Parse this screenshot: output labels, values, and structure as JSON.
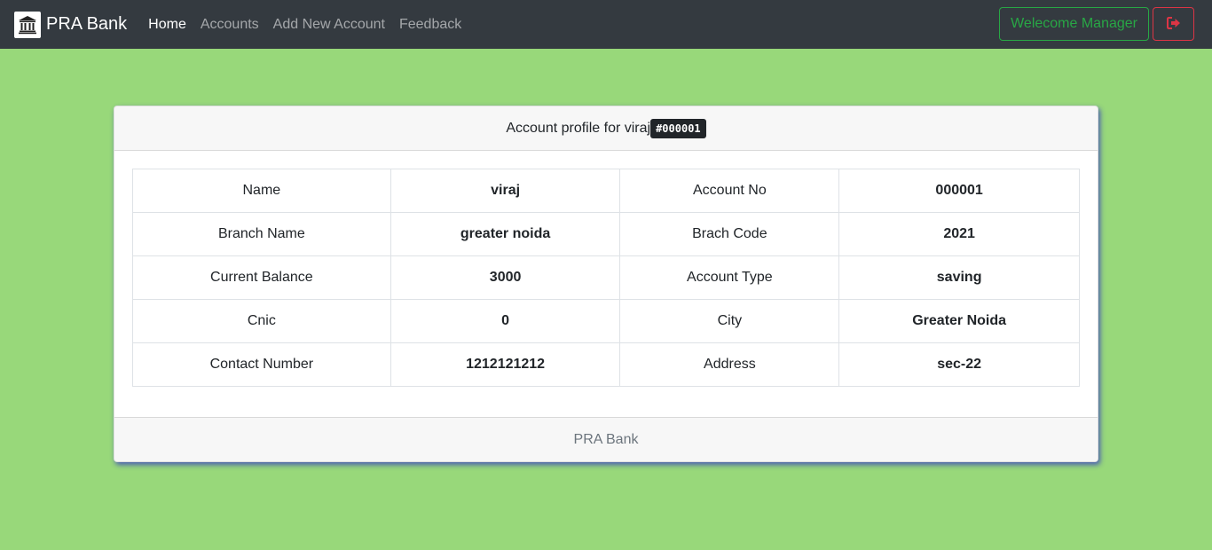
{
  "colors": {
    "page_background": "#98d87a",
    "navbar_background": "#343a40",
    "welcome_accent": "#28a745",
    "logout_accent": "#dc3545",
    "card_shadow": "#3c46be"
  },
  "navbar": {
    "brand": "PRA Bank",
    "brand_icon": "bank-icon",
    "links": [
      {
        "label": "Home",
        "active": true
      },
      {
        "label": "Accounts",
        "active": false
      },
      {
        "label": "Add New Account",
        "active": false
      },
      {
        "label": "Feedback",
        "active": false
      }
    ],
    "welcome_label": "Welecome Manager",
    "logout_icon": "sign-out-icon"
  },
  "profile": {
    "header_text": "Account profile for viraj",
    "account_badge": "#000001",
    "footer_text": "PRA Bank",
    "rows": [
      [
        "Name",
        "viraj",
        "Account No",
        "000001"
      ],
      [
        "Branch Name",
        "greater noida",
        "Brach Code",
        "2021"
      ],
      [
        "Current Balance",
        "3000",
        "Account Type",
        "saving"
      ],
      [
        "Cnic",
        "0",
        "City",
        "Greater Noida"
      ],
      [
        "Contact Number",
        "1212121212",
        "Address",
        "sec-22"
      ]
    ]
  }
}
